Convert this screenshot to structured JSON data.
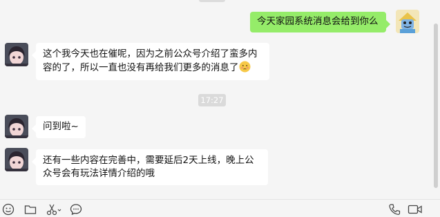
{
  "messages": [
    {
      "sender": "self",
      "text": "今天家园系统消息会给到你么"
    },
    {
      "sender": "contact",
      "text": "这个我今天也在催呢，因为之前公众号介绍了蛮多内容的了，所以一直也没有再给我们更多的消息了",
      "emoji": "embarrassed-face-icon"
    },
    {
      "sender": "contact",
      "text": "问到啦~"
    },
    {
      "sender": "contact",
      "text": "还有一些内容在完善中，需要延后2天上线，晚上公众号会有玩法详情介绍的哦"
    }
  ],
  "timestamp": "17:27",
  "toolbar": {
    "left_icons": [
      "emoji-icon",
      "folder-icon",
      "scissors-icon",
      "chat-history-icon"
    ],
    "right_icons": [
      "phone-icon",
      "video-call-icon"
    ]
  },
  "colors": {
    "outgoing_bubble": "#95ec69",
    "incoming_bubble": "#ffffff",
    "background": "#f5f5f5"
  }
}
